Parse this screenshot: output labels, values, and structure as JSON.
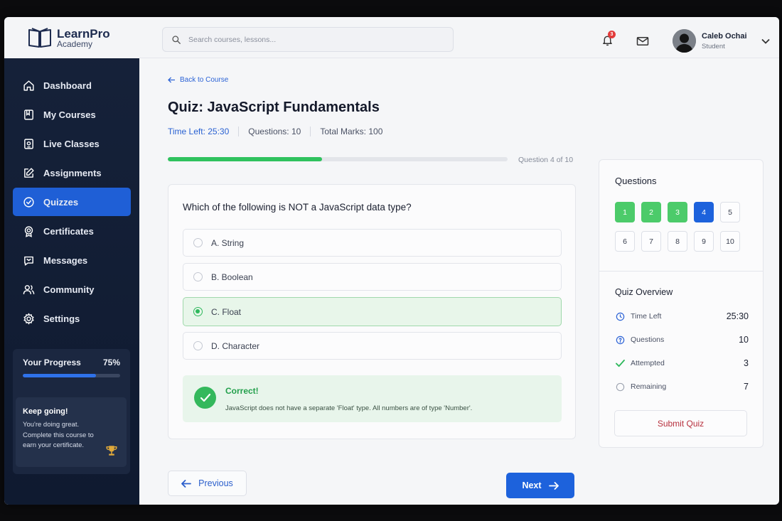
{
  "brand": {
    "name": "LearnPro",
    "sub": "Academy"
  },
  "search": {
    "placeholder": "Search courses, lessons..."
  },
  "notifications": {
    "count": "3"
  },
  "user": {
    "name": "Caleb Ochai",
    "role": "Student"
  },
  "sidebar": {
    "items": [
      {
        "label": "Dashboard",
        "icon": "home-icon"
      },
      {
        "label": "My Courses",
        "icon": "book-icon"
      },
      {
        "label": "Live Classes",
        "icon": "video-icon"
      },
      {
        "label": "Assignments",
        "icon": "edit-icon"
      },
      {
        "label": "Quizzes",
        "icon": "check-circle-icon",
        "active": true
      },
      {
        "label": "Certificates",
        "icon": "certificate-icon"
      },
      {
        "label": "Messages",
        "icon": "chat-icon"
      },
      {
        "label": "Community",
        "icon": "users-icon"
      },
      {
        "label": "Settings",
        "icon": "gear-icon"
      }
    ],
    "progress": {
      "label": "Your Progress",
      "value": "75%",
      "fraction": 0.75
    },
    "keep_going": {
      "title": "Keep going!",
      "text": "You're doing great. Complete this course to earn your certificate."
    }
  },
  "quiz": {
    "back": "Back to Course",
    "title": "Quiz: JavaScript Fundamentals",
    "time_left": "Time Left: 25:30",
    "questions": "Questions: 10",
    "marks": "Total Marks: 100",
    "progress_fraction": 0.455,
    "question_of": "Question 4 of 10",
    "question": "Which of the following is NOT a JavaScript data type?",
    "options": [
      "A. String",
      "B. Boolean",
      "C. Float",
      "D. Character"
    ],
    "selected_index": 2,
    "feedback": {
      "title": "Correct!",
      "text": "JavaScript does not have a separate 'Float' type. All numbers are of type 'Number'."
    },
    "prev": "Previous",
    "next": "Next"
  },
  "panel": {
    "questions_title": "Questions",
    "numbers": [
      "1",
      "2",
      "3",
      "4",
      "5",
      "6",
      "7",
      "8",
      "9",
      "10"
    ],
    "status": [
      "done",
      "done",
      "done",
      "current",
      "",
      "",
      "",
      "",
      "",
      ""
    ],
    "overview_title": "Quiz Overview",
    "overview": [
      {
        "label": "Time Left",
        "value": "25:30",
        "icon": "clock-icon"
      },
      {
        "label": "Questions",
        "value": "10",
        "icon": "question-icon"
      },
      {
        "label": "Attempted",
        "value": "3",
        "icon": "check-icon"
      },
      {
        "label": "Remaining",
        "value": "7",
        "icon": "circle-icon"
      }
    ],
    "submit": "Submit Quiz"
  },
  "colors": {
    "accent": "#1d62dc",
    "success": "#34b85c",
    "sidebar": "#16223a",
    "danger": "#b7303d"
  }
}
